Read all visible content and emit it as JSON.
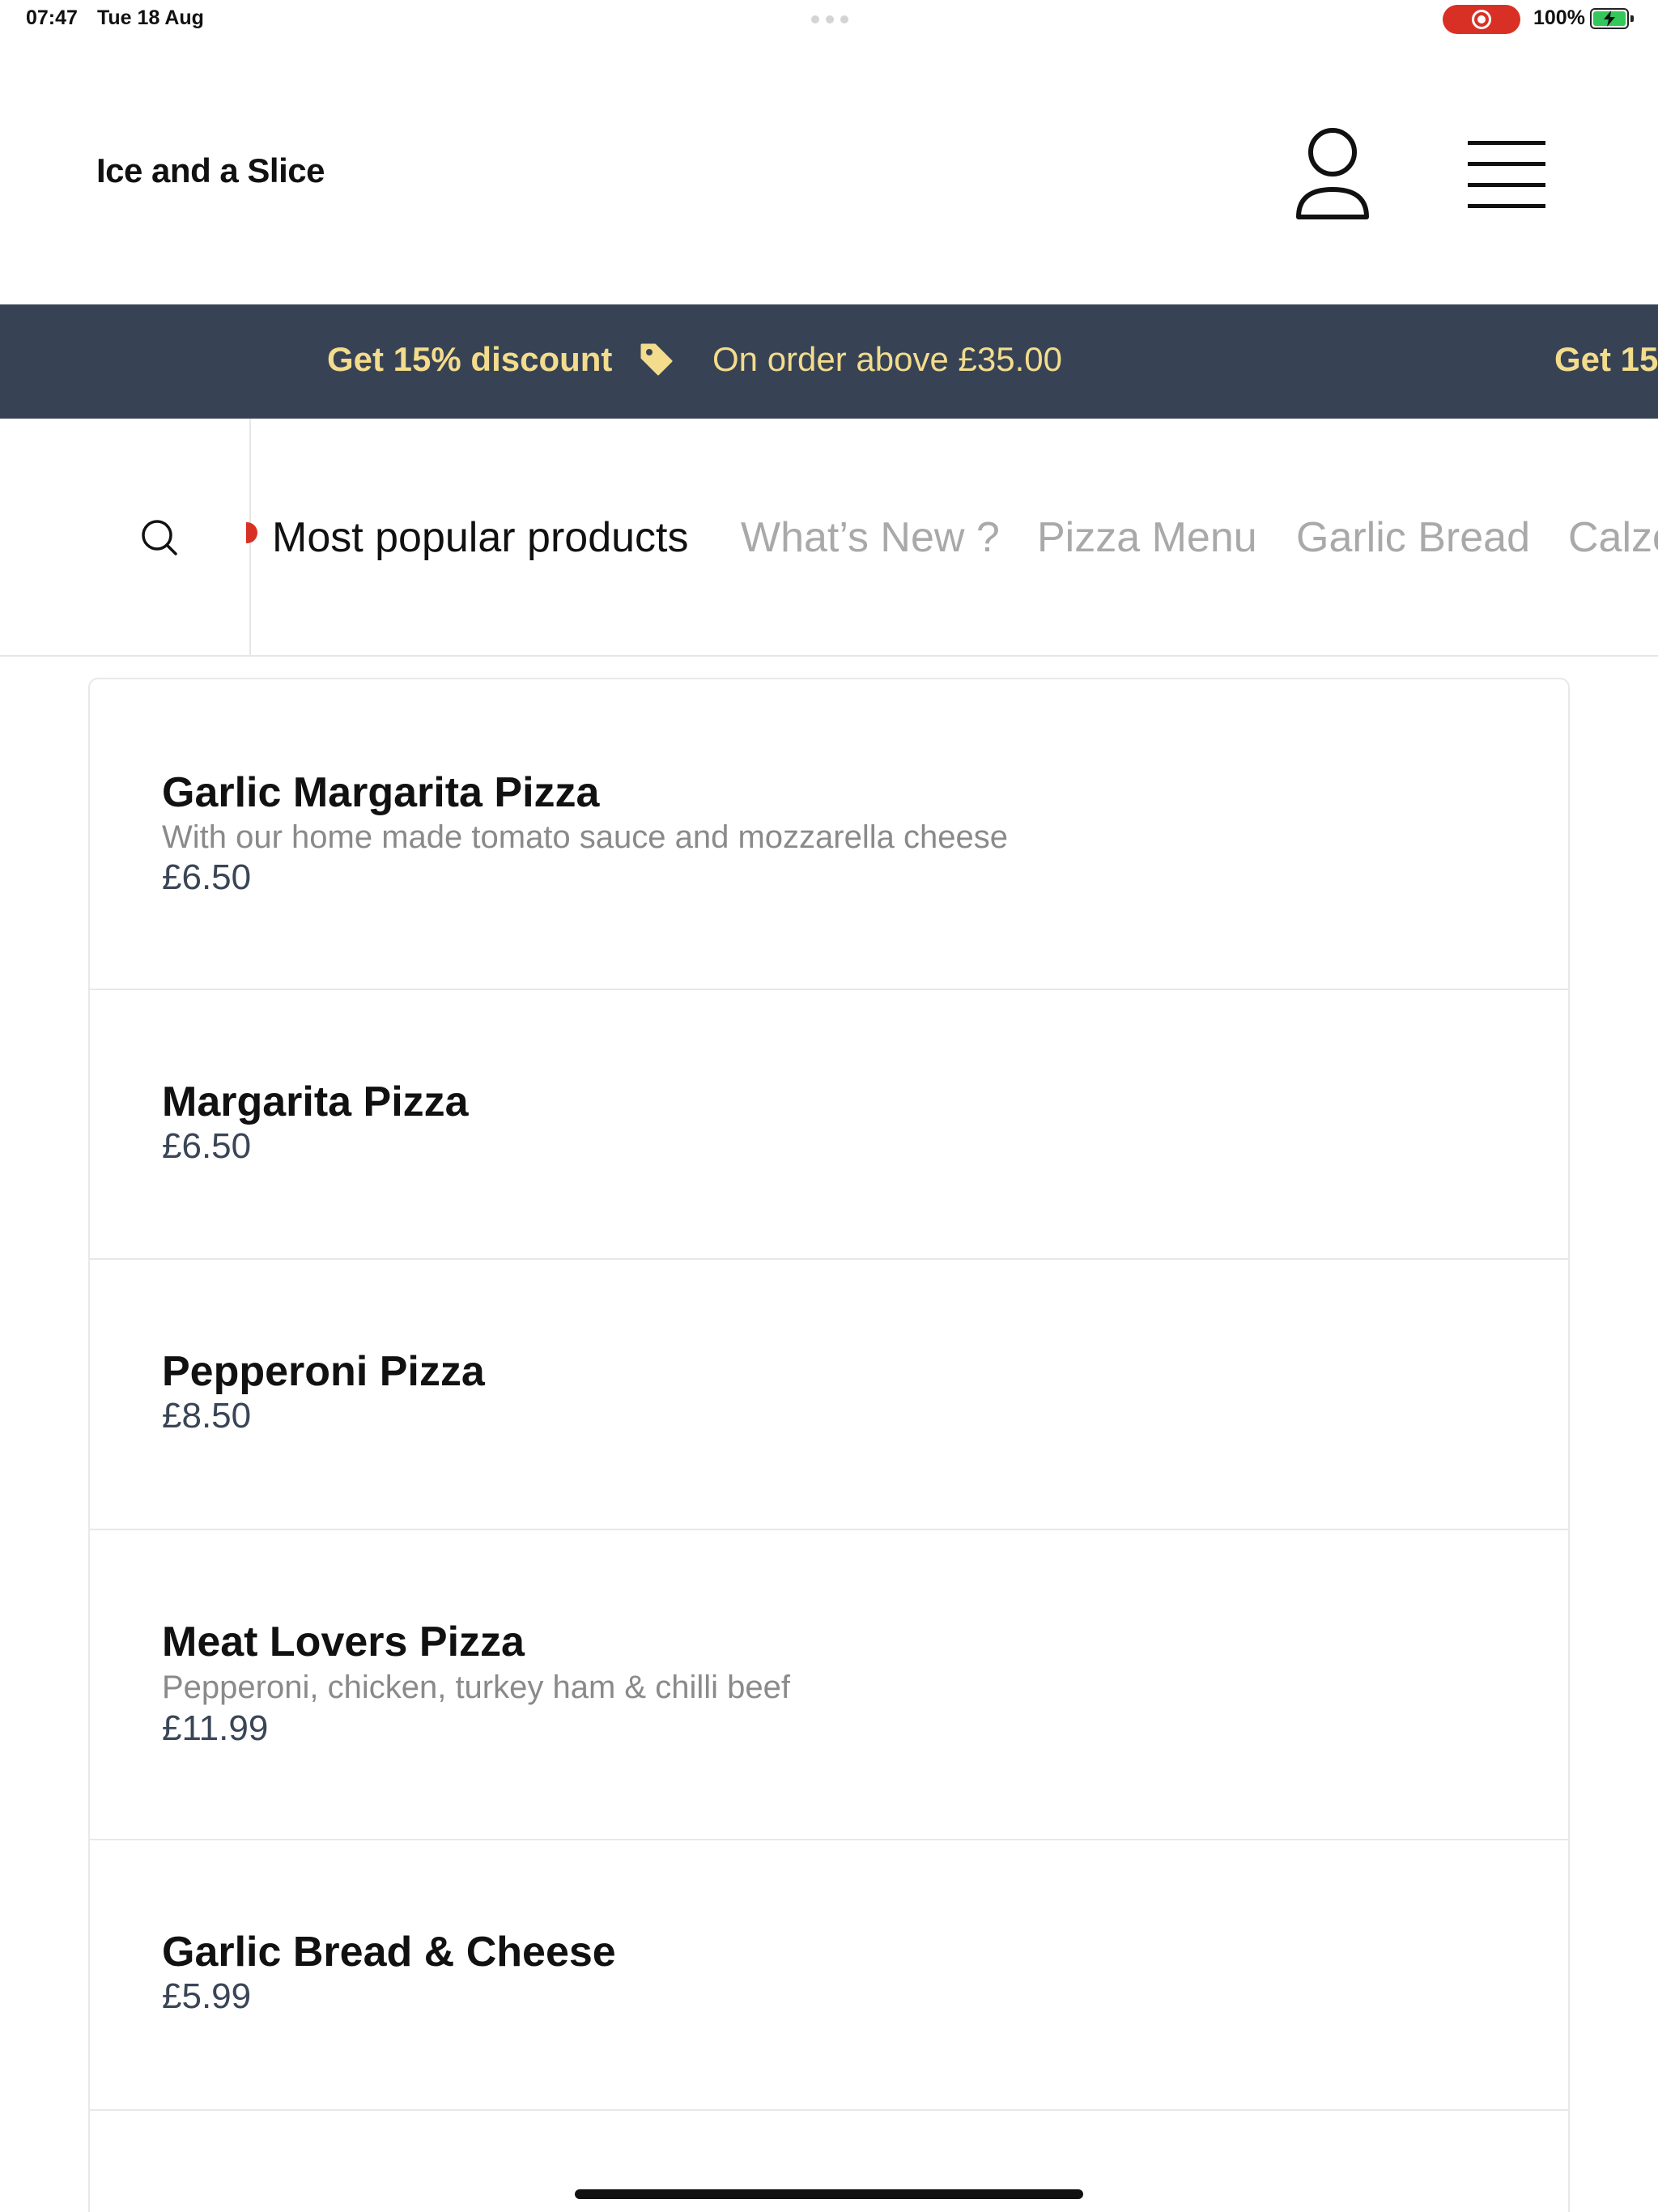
{
  "status_bar": {
    "time": "07:47",
    "date": "Tue 18 Aug",
    "battery": "100%"
  },
  "header": {
    "brand": "Ice and a Slice",
    "icons": {
      "account": "user-icon",
      "menu": "hamburger-menu-icon"
    }
  },
  "promo": {
    "headline": "Get 15% discount",
    "detail": "On order above £35.00",
    "repeat_headline": "Get 15%",
    "icon": "tag-icon",
    "colors": {
      "background": "#374355",
      "text": "#f3dc8c"
    }
  },
  "categories": {
    "search_icon": "search-icon",
    "tabs": [
      {
        "label": "Most popular products",
        "active": true
      },
      {
        "label": "What’s New ?",
        "active": false
      },
      {
        "label": "Pizza Menu",
        "active": false
      },
      {
        "label": "Garlic Bread",
        "active": false
      },
      {
        "label": "Calzo",
        "active": false
      }
    ]
  },
  "products": [
    {
      "name": "Garlic Margarita Pizza",
      "description": "With our home made tomato sauce and mozzarella cheese",
      "price": "£6.50"
    },
    {
      "name": "Margarita Pizza",
      "description": "",
      "price": "£6.50"
    },
    {
      "name": "Pepperoni Pizza",
      "description": "",
      "price": "£8.50"
    },
    {
      "name": "Meat Lovers Pizza",
      "description": "Pepperoni, chicken, turkey ham & chilli beef",
      "price": "£11.99"
    },
    {
      "name": "Garlic Bread & Cheese",
      "description": "",
      "price": "£5.99"
    }
  ]
}
